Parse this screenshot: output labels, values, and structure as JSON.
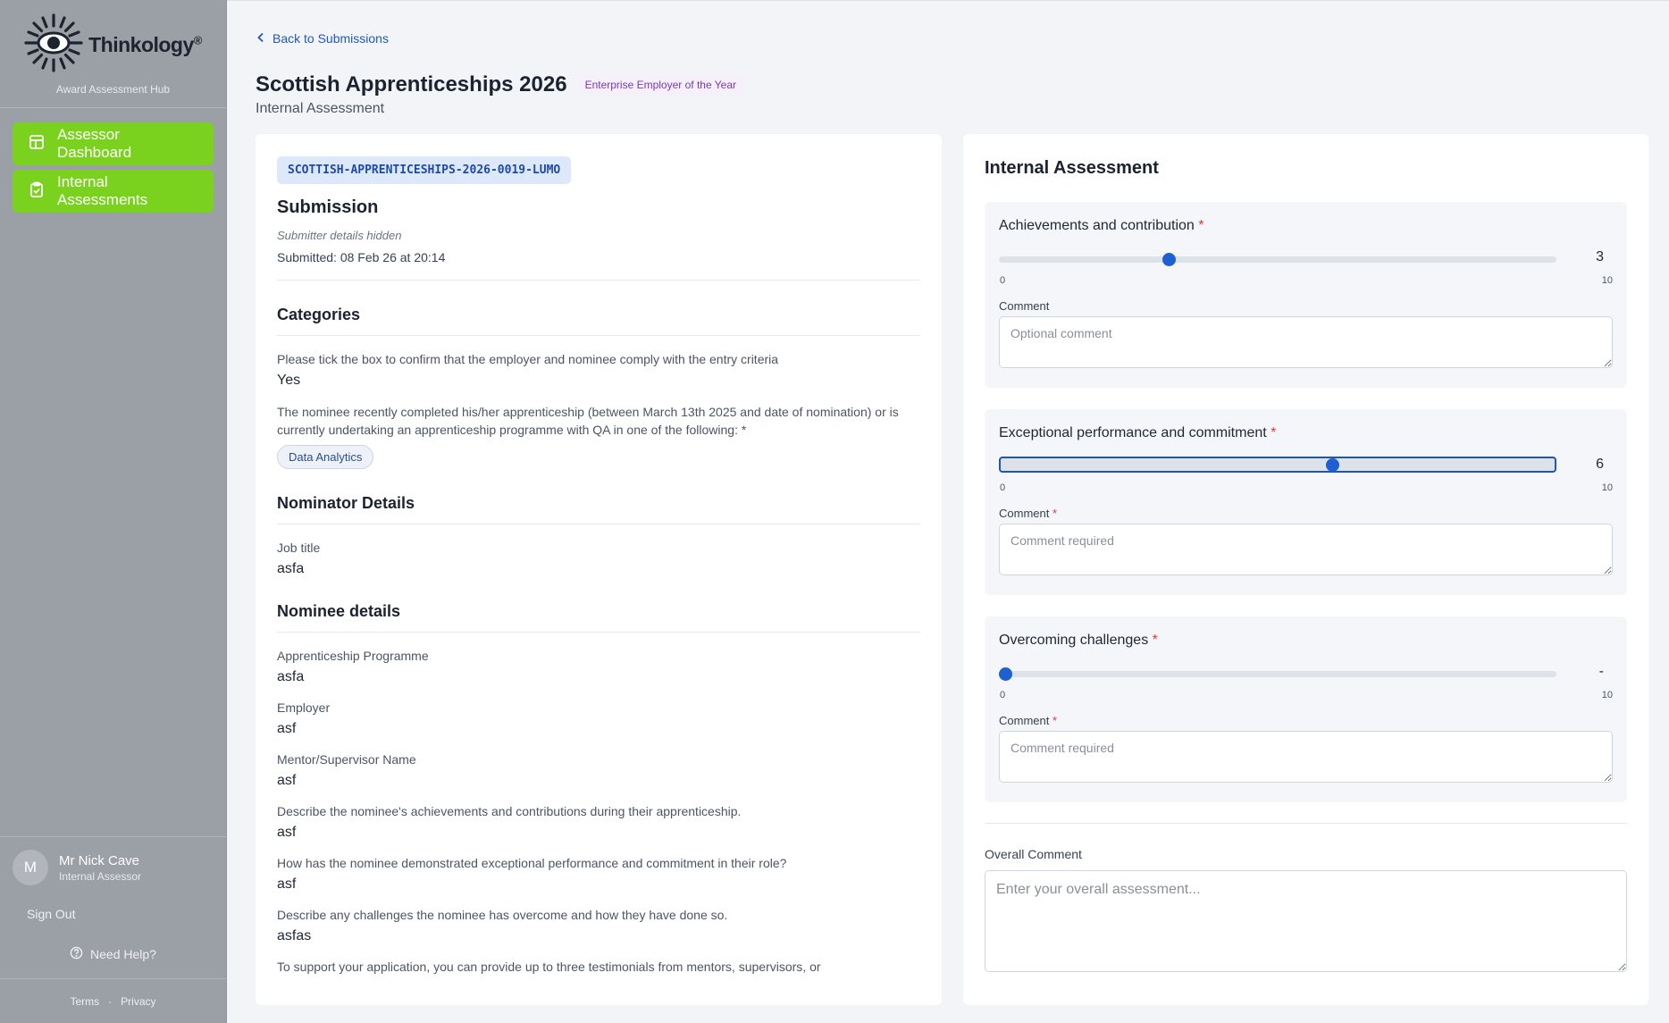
{
  "sidebar": {
    "logo_text": "Thinkology",
    "logo_mark": "®",
    "subtitle": "Award Assessment Hub",
    "nav": [
      {
        "label": "Assessor Dashboard",
        "icon": "dashboard-icon"
      },
      {
        "label": "Internal Assessments",
        "icon": "clipboard-check-icon"
      }
    ],
    "user": {
      "initial": "M",
      "name": "Mr Nick Cave",
      "role": "Internal Assessor"
    },
    "sign_out": "Sign Out",
    "help": "Need Help?",
    "legal": {
      "terms": "Terms",
      "separator": "·",
      "privacy": "Privacy"
    }
  },
  "header": {
    "back_label": "Back to Submissions",
    "title": "Scottish Apprenticeships 2026",
    "badge": "Enterprise Employer of the Year",
    "subtitle": "Internal Assessment"
  },
  "submission": {
    "reference": "SCOTTISH-APPRENTICESHIPS-2026-0019-LUMO",
    "heading": "Submission",
    "submitter_note": "Submitter details hidden",
    "submitted_label": "Submitted:",
    "submitted_value": "08 Feb 26 at 20:14",
    "categories": {
      "heading": "Categories",
      "fields": [
        {
          "label": "Please tick the box to confirm that the employer and nominee comply with the entry criteria",
          "value": "Yes"
        },
        {
          "label": "The nominee recently completed his/her apprenticeship (between March 13th 2025 and date of nomination) or is currently undertaking an apprenticeship programme with QA in one of the following: *",
          "tag": "Data Analytics"
        }
      ]
    },
    "nominator": {
      "heading": "Nominator Details",
      "fields": [
        {
          "label": "Job title",
          "value": "asfa"
        }
      ]
    },
    "nominee": {
      "heading": "Nominee details",
      "fields": [
        {
          "label": "Apprenticeship Programme",
          "value": "asfa"
        },
        {
          "label": "Employer",
          "value": "asf"
        },
        {
          "label": "Mentor/Supervisor Name",
          "value": "asf"
        },
        {
          "label": "Describe the nominee's achievements and contributions during their apprenticeship.",
          "value": "asf"
        },
        {
          "label": "How has the nominee demonstrated exceptional performance and commitment in their role?",
          "value": "asf"
        },
        {
          "label": "Describe any challenges the nominee has overcome and how they have done so.",
          "value": "asfas"
        },
        {
          "label": "To support your application, you can provide up to three testimonials from mentors, supervisors, or",
          "value": ""
        }
      ]
    }
  },
  "assessment": {
    "heading": "Internal Assessment",
    "scale_min": "0",
    "scale_max": "10",
    "required_mark": "*",
    "criteria": [
      {
        "title": "Achievements and contribution",
        "score": 3,
        "score_display": "3",
        "comment_label": "Comment",
        "comment_required": false,
        "placeholder": "Optional comment",
        "focused": false
      },
      {
        "title": "Exceptional performance and commitment",
        "score": 6,
        "score_display": "6",
        "comment_label": "Comment",
        "comment_required": true,
        "placeholder": "Comment required",
        "focused": true
      },
      {
        "title": "Overcoming challenges",
        "score": 0,
        "score_display": "-",
        "comment_label": "Comment",
        "comment_required": true,
        "placeholder": "Comment required",
        "focused": false
      }
    ],
    "overall_label": "Overall Comment",
    "overall_placeholder": "Enter your overall assessment..."
  },
  "colors": {
    "accent_green": "#7ad21f",
    "link_blue": "#2159b8",
    "slider_blue": "#1e5fd1",
    "badge_purple": "#7a38b8",
    "required_red": "#e53935"
  }
}
